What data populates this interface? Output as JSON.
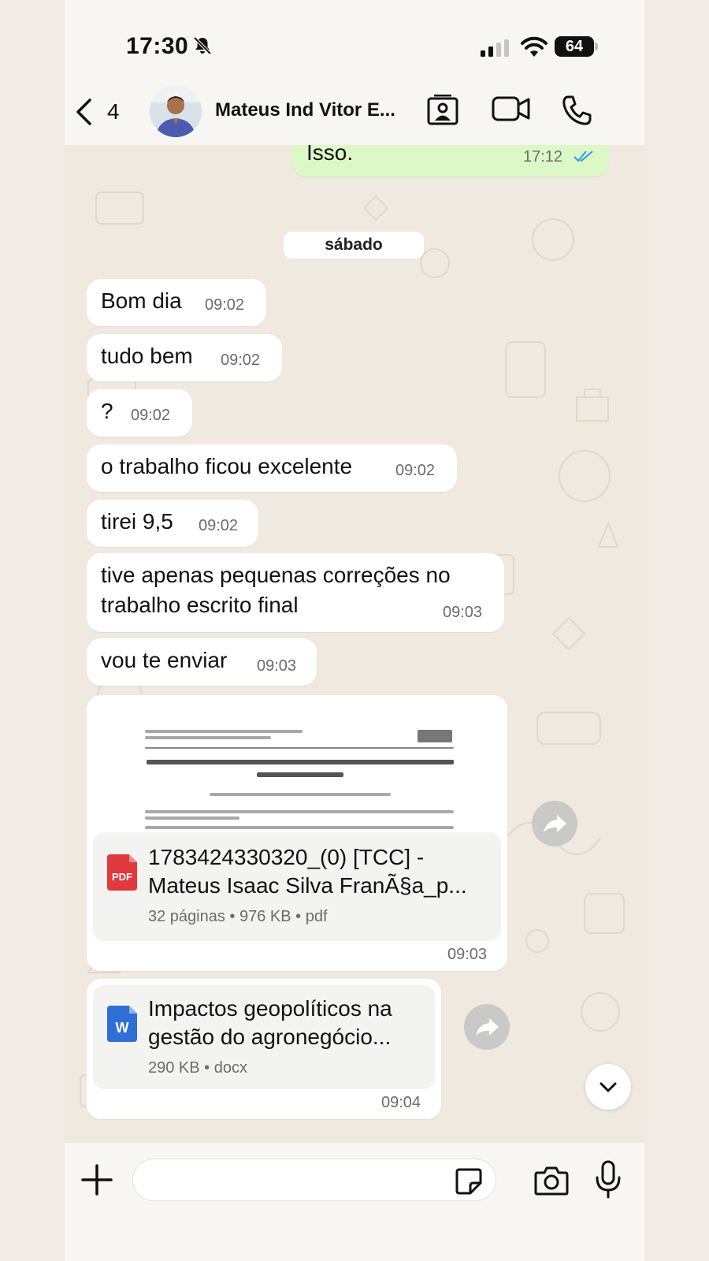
{
  "status_bar": {
    "time": "17:30",
    "battery": "64"
  },
  "header": {
    "back_count": "4",
    "contact_name": "Mateus Ind Vitor E..."
  },
  "chat": {
    "outgoing_top": {
      "text": "Isso.",
      "time": "17:12"
    },
    "date_separator": "sábado",
    "messages": [
      {
        "text": "Bom dia",
        "time": "09:02"
      },
      {
        "text": "tudo bem",
        "time": "09:02"
      },
      {
        "text": "?",
        "time": "09:02"
      },
      {
        "text": "o trabalho ficou excelente",
        "time": "09:02"
      },
      {
        "text": "tirei 9,5",
        "time": "09:02"
      },
      {
        "text_line1": "tive apenas pequenas correções no",
        "text_line2": "trabalho escrito final",
        "time": "09:03"
      },
      {
        "text": "vou te enviar",
        "time": "09:03"
      }
    ],
    "pdf_doc": {
      "icon_label": "PDF",
      "title_line1": "1783424330320_(0) [TCC] -",
      "title_line2": "Mateus Isaac Silva FranÃ§a_p...",
      "meta": "32 páginas • 976 KB • pdf",
      "time": "09:03"
    },
    "docx_doc": {
      "icon_label": "W",
      "title_line1": "Impactos geopolíticos na",
      "title_line2": "gestão do agronegócio...",
      "meta": "290 KB • docx",
      "time": "09:04"
    }
  },
  "colors": {
    "outgoing_bubble": "#dcf8c6",
    "incoming_bubble": "#ffffff",
    "pdf_icon": "#e0393e",
    "word_icon": "#2f6fd6",
    "read_ticks": "#3497f9"
  },
  "icons": [
    "bell-slash-icon",
    "signal-icon",
    "wifi-icon",
    "back-chevron-icon",
    "contact-card-icon",
    "video-call-icon",
    "phone-icon",
    "forward-icon",
    "chevron-down-icon",
    "plus-icon",
    "sticker-icon",
    "camera-icon",
    "microphone-icon"
  ]
}
